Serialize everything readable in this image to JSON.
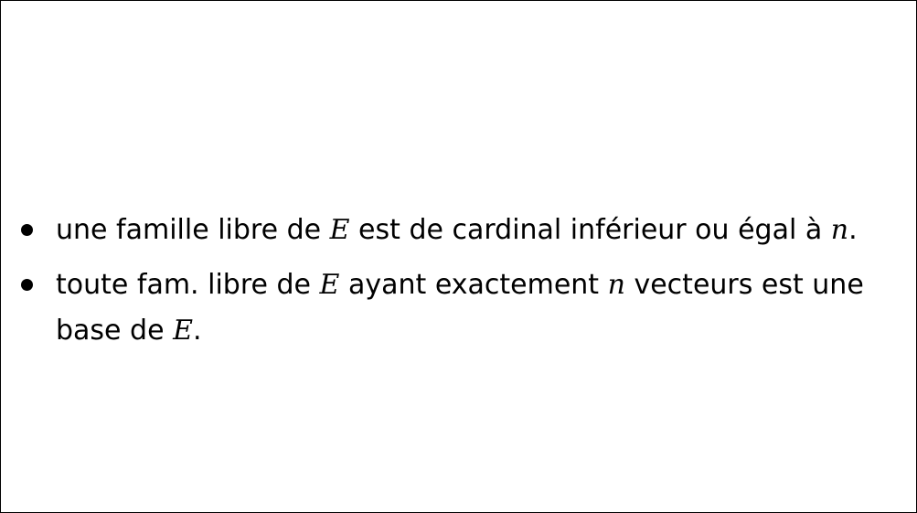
{
  "bullets": [
    {
      "part1": "une famille libre de ",
      "math1": "E",
      "part2": " est de cardinal inférieur ou égal à ",
      "math2": "n",
      "part3": "."
    },
    {
      "part1": "toute fam. libre de ",
      "math1": "E",
      "part2": " ayant exactement ",
      "math2": "n",
      "part3": " vecteurs est une",
      "line2_part1": "base de ",
      "line2_math": "E",
      "line2_part2": "."
    }
  ]
}
